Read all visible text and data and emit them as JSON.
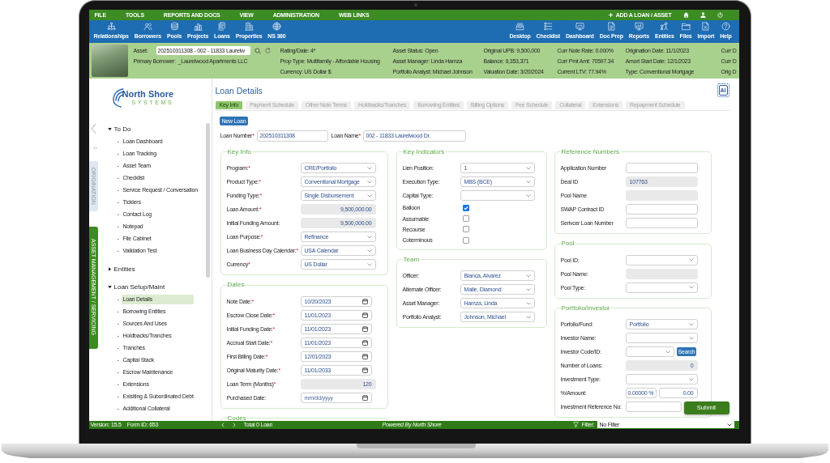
{
  "menu_bar": {
    "items": [
      "FILE",
      "TOOLS",
      "REPORTS AND DOCS",
      "VIEW",
      "ADMINISTRATION",
      "WEB LINKS"
    ],
    "add_label": "ADD A LOAN / ASSET"
  },
  "toolbar": {
    "left": [
      {
        "label": "Relationships",
        "kind": "hierarchy"
      },
      {
        "label": "Borrowers",
        "kind": "people"
      },
      {
        "label": "Pools",
        "kind": "coins"
      },
      {
        "label": "Projects",
        "kind": "chart"
      },
      {
        "label": "Loans",
        "kind": "documents"
      },
      {
        "label": "Properties",
        "kind": "building"
      },
      {
        "label": "NS 360",
        "kind": "globe"
      }
    ],
    "right": [
      {
        "label": "Desktop",
        "kind": "tray"
      },
      {
        "label": "Checklist",
        "kind": "checklist"
      },
      {
        "label": "Dashboard",
        "kind": "monitor"
      },
      {
        "label": "Doc Prep",
        "kind": "document"
      },
      {
        "label": "Reports",
        "kind": "report"
      },
      {
        "label": "Entities",
        "kind": "network"
      },
      {
        "label": "Files",
        "kind": "folder"
      },
      {
        "label": "Import",
        "kind": "spreadsheet"
      },
      {
        "label": "Help",
        "kind": "help"
      }
    ]
  },
  "asset_bar": {
    "asset_label": "Asset:",
    "asset_value": "202510311308 - 002 - 11833 Laurelw",
    "borrower_label": "Primary Borrower:",
    "borrower_value": "_Laurelwood Apartments LLC",
    "columns": [
      [
        "Rating/Date: 4*",
        "Prop Type: Multifamily - Affordable Housing",
        "Currency: US Dollar $"
      ],
      [
        "Asset Status: Open",
        "Asset Manager: Linda Hamza",
        "Portfolio Analyst: Michael Johnson"
      ],
      [
        "Original UPB: 9,500,000",
        "Balance: 9,353,371",
        "Valuation Date: 3/20/2024"
      ],
      [
        "Curr Note Rate: 0.000%",
        "Curr Pmt Amt: 70597.34",
        "Current LTV: 77.94%"
      ],
      [
        "Origination Date: 11/1/2023",
        "Amort Start Date: 12/1/2023",
        "Type: Conventional Mortgage"
      ],
      [
        "Curr D",
        "Curr D",
        "Orig D"
      ]
    ]
  },
  "sidebar": {
    "logo_name": "North Shore",
    "logo_tagline": "SYSTEMS",
    "side_tabs": [
      {
        "label": "ORIGINATION",
        "selected": false
      },
      {
        "label": "ASSET MANAGEMENT / SERVICING",
        "selected": true
      }
    ],
    "tree": [
      {
        "label": "To Do",
        "expanded": true,
        "children": [
          {
            "marker": "-",
            "label": "Loan Dashboard",
            "selected": false
          },
          {
            "marker": "-",
            "label": "Loan Tracking",
            "selected": false
          },
          {
            "marker": "-",
            "label": "Asset Team",
            "selected": false
          },
          {
            "marker": "-",
            "label": "Checklist",
            "selected": false
          },
          {
            "marker": "-",
            "label": "Service Request / Conversation",
            "selected": false
          },
          {
            "marker": "-",
            "label": "Ticklers",
            "selected": false
          },
          {
            "marker": "-",
            "label": "Contact Log",
            "selected": false
          },
          {
            "marker": "-",
            "label": "Notepad",
            "selected": false
          },
          {
            "marker": "-",
            "label": "File Cabinet",
            "selected": false
          },
          {
            "marker": "-",
            "label": "Validation Test",
            "selected": false
          }
        ]
      },
      {
        "label": "Entities",
        "expanded": false
      },
      {
        "label": "Loan Setup/Maint",
        "expanded": true,
        "children": [
          {
            "marker": "-",
            "label": "Loan Details",
            "selected": true
          },
          {
            "marker": "-",
            "label": "Borrowing Entities",
            "selected": false
          },
          {
            "marker": "-",
            "label": "Sources And Uses",
            "selected": false
          },
          {
            "marker": "-",
            "label": "Holdbacks/Tranches",
            "selected": false
          },
          {
            "marker": "-",
            "label": "Tranches",
            "selected": false
          },
          {
            "marker": "-",
            "label": "Capital Stack",
            "selected": false
          },
          {
            "marker": "-",
            "label": "Escrow Maintenance",
            "selected": false
          },
          {
            "marker": "-",
            "label": "Extensions",
            "selected": false
          },
          {
            "marker": "-",
            "label": "Exisiting & Subordinated Debt",
            "selected": false
          },
          {
            "marker": "-",
            "label": "Additional Collateral",
            "selected": false
          }
        ]
      }
    ]
  },
  "content": {
    "title": "Loan Details",
    "ai_label": "AI",
    "tabs": [
      {
        "label": "Key Info",
        "selected": true
      },
      {
        "label": "Payment Schedule",
        "selected": false
      },
      {
        "label": "Other Note Terms",
        "selected": false
      },
      {
        "label": "Holdbacks/Tranches",
        "selected": false
      },
      {
        "label": "Borrowing Entities",
        "selected": false
      },
      {
        "label": "Billing Options",
        "selected": false
      },
      {
        "label": "Fee Schedule",
        "selected": false
      },
      {
        "label": "Collateral",
        "selected": false
      },
      {
        "label": "Extensions",
        "selected": false
      },
      {
        "label": "Repayment Schedule",
        "selected": false
      }
    ],
    "new_button": "New Loan",
    "header_fields": [
      {
        "label": "Loan Number",
        "mark": "*",
        "value": "202510311308"
      },
      {
        "label": "Loan Name",
        "mark": "*",
        "value": "002 - 11833 Laurelwood Dr."
      }
    ],
    "columns": [
      [
        {
          "title": "Key Info",
          "rows": [
            {
              "label": "Program:",
              "mark": "*",
              "kind": "select",
              "value": "CRE/Portfolio"
            },
            {
              "label": "Product Type:",
              "mark": "*",
              "kind": "select",
              "value": "Conventional Mortgage"
            },
            {
              "label": "Funding Type:",
              "mark": "*",
              "kind": "select",
              "value": "Single Disbursement"
            },
            {
              "label": "Loan Amount:",
              "mark": "*",
              "kind": "amount",
              "value": "9,500,000.00"
            },
            {
              "label": "Initial Funding Amount:",
              "kind": "amount",
              "value": "9,500,000.00"
            },
            {
              "label": "Loan Purpose:",
              "mark": "*",
              "kind": "select",
              "value": "Refinance"
            },
            {
              "label": "Loan Business Day Calendar:",
              "mark": "*",
              "kind": "select",
              "value": "USA Calendar"
            },
            {
              "label": "Currency",
              "mark": "*",
              "kind": "select",
              "value": "US Dollar"
            }
          ]
        },
        {
          "title": "Dates",
          "rows": [
            {
              "label": "Note Date:",
              "mark": "*",
              "kind": "date",
              "value": "10/20/2023"
            },
            {
              "label": "Escrow Close Date:",
              "mark": "*",
              "kind": "date",
              "value": "11/01/2023"
            },
            {
              "label": "Initial Funding Date:",
              "mark": "*",
              "kind": "date",
              "value": "11/01/2023"
            },
            {
              "label": "Accrual Start Date:",
              "mark": "*",
              "kind": "date",
              "value": "11/01/2023"
            },
            {
              "label": "First Billing Date:",
              "mark": "*",
              "kind": "date",
              "value": "12/01/2023"
            },
            {
              "label": "Original Maturity Date:",
              "mark": "*",
              "kind": "date",
              "value": "11/01/2033"
            },
            {
              "label": "Loan Term (Months)",
              "mark": "*",
              "kind": "amount",
              "value": "120"
            },
            {
              "label": "Purchased Date:",
              "kind": "date",
              "placeholder": "mm/dd/yyyy"
            }
          ]
        },
        {
          "title": "Codes"
        }
      ],
      [
        {
          "title": "Key Indicators",
          "rows": [
            {
              "label": "Lien Position:",
              "kind": "select",
              "value": "1"
            },
            {
              "label": "Execution Type:",
              "kind": "select",
              "value": "MBS (BCE)"
            },
            {
              "label": "Capital Type:",
              "kind": "select"
            },
            {
              "label": "Balloon",
              "kind": "checkbox",
              "checked": true
            },
            {
              "label": "Assumable",
              "kind": "checkbox",
              "checked": false
            },
            {
              "label": "Recourse",
              "kind": "checkbox",
              "checked": false
            },
            {
              "label": "Coterminous",
              "kind": "checkbox",
              "checked": false
            }
          ]
        },
        {
          "title": "Team",
          "rows": [
            {
              "label": "Officer:",
              "kind": "select",
              "value": "Bianca, Alvarez"
            },
            {
              "label": "Alternate Officer:",
              "kind": "select",
              "value": "Maile, Diamond"
            },
            {
              "label": "Asset Manager:",
              "kind": "select",
              "value": "Hamza, Linda"
            },
            {
              "label": "Portfolio Analyst:",
              "kind": "select",
              "value": "Johnson, Michael"
            }
          ]
        }
      ],
      [
        {
          "title": "Reference Numbers",
          "rows": [
            {
              "label": "Application Number",
              "kind": "text"
            },
            {
              "label": "Deal ID",
              "kind": "readonly",
              "value": "107763"
            },
            {
              "label": "Pool Name",
              "kind": "readonly"
            },
            {
              "label": "SWAP Contract ID",
              "kind": "text"
            },
            {
              "label": "Serivcer Loan Number",
              "kind": "text"
            }
          ]
        },
        {
          "title": "Pool",
          "rows": [
            {
              "label": "Pool ID:",
              "kind": "select"
            },
            {
              "label": "Pool Name:",
              "kind": "readonly"
            },
            {
              "label": "Pool Type:",
              "kind": "select"
            }
          ]
        },
        {
          "title": "Portfolio/Investor",
          "rows": [
            {
              "label": "Porfolio/Fund:",
              "kind": "select",
              "value": "Portfolio"
            },
            {
              "label": "Investor Name:",
              "kind": "select"
            },
            {
              "label": "Investor Code/ID:",
              "kind": "select_search",
              "button": "Search"
            },
            {
              "label": "Number of Loans:",
              "kind": "amount",
              "value": "0"
            },
            {
              "label": "Investment Type:",
              "kind": "select"
            },
            {
              "label": "%/Amount:",
              "kind": "split",
              "values": [
                "0.00000 %",
                "0.00"
              ]
            },
            {
              "label": "Investment Reference No:",
              "kind": "text"
            }
          ]
        }
      ]
    ],
    "submit": "Submit"
  },
  "footer": {
    "version": "Version: 15.5",
    "form_id": "Form ID: 653",
    "total": "Total 0 Loan",
    "powered": "Powered By North Shore",
    "filter_label": "Filter:",
    "filter_value": "No Filter"
  }
}
